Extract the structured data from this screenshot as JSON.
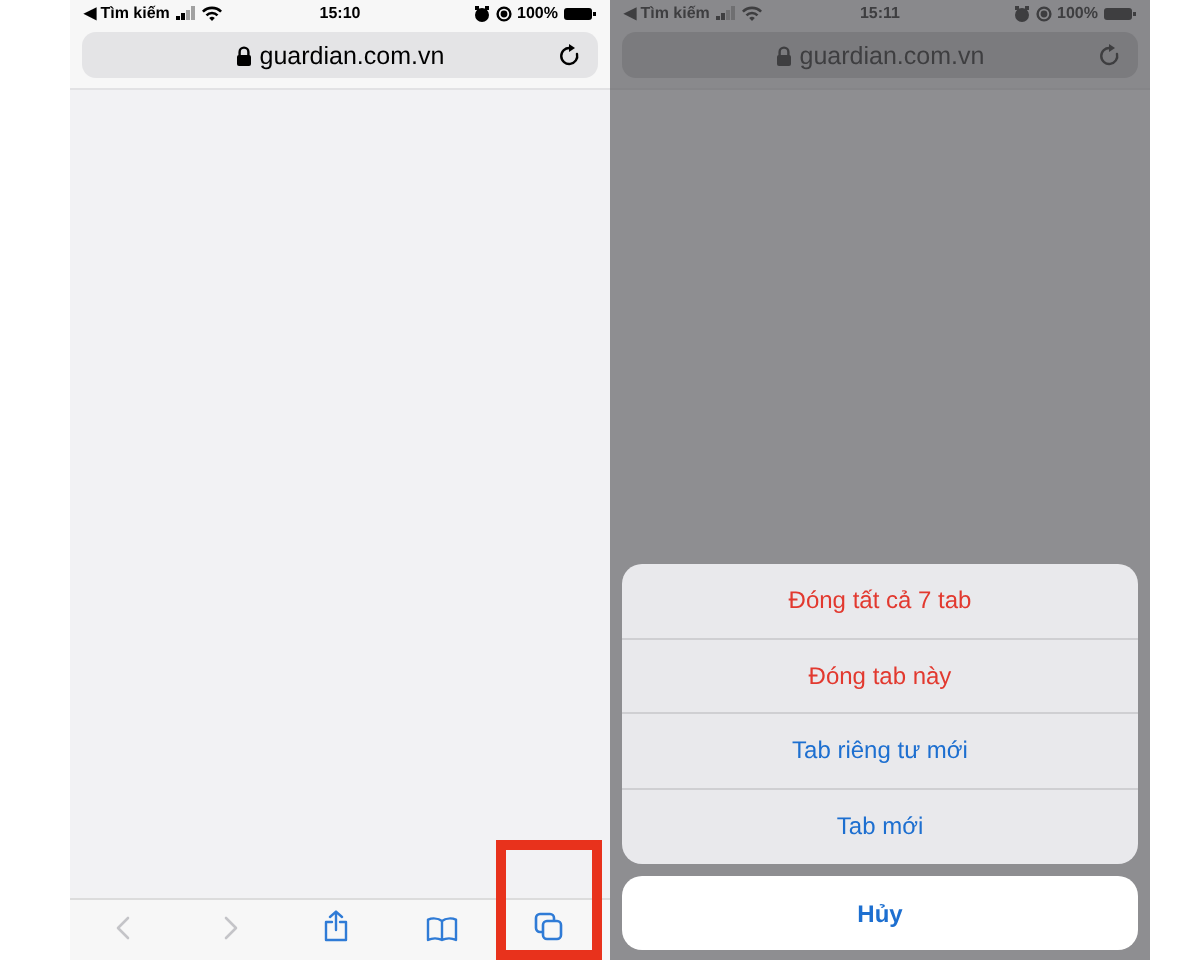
{
  "screens": [
    {
      "dimmed": false,
      "status_bar": {
        "back_label": "◀ Tìm kiếm",
        "time": "15:10",
        "battery": "100%"
      },
      "address_bar": {
        "url": "guardian.com.vn"
      },
      "toolbar": [
        {
          "kind": "back",
          "disabled": true,
          "highlighted": false
        },
        {
          "kind": "forward",
          "disabled": true,
          "highlighted": false
        },
        {
          "kind": "share",
          "disabled": false,
          "highlighted": false
        },
        {
          "kind": "bookmarks",
          "disabled": false,
          "highlighted": false
        },
        {
          "kind": "tabs",
          "disabled": false,
          "highlighted": true
        }
      ]
    },
    {
      "dimmed": true,
      "status_bar": {
        "back_label": "◀ Tìm kiếm",
        "time": "15:11",
        "battery": "100%"
      },
      "address_bar": {
        "url": "guardian.com.vn"
      },
      "action_sheet": {
        "actions": [
          {
            "label": "Đóng tất cả 7 tab",
            "kind": "destructive"
          },
          {
            "label": "Đóng tab này",
            "kind": "destructive"
          },
          {
            "label": "Tab riêng tư mới",
            "kind": "default"
          },
          {
            "label": "Tab mới",
            "kind": "default"
          }
        ],
        "cancel": "Hủy"
      }
    }
  ]
}
